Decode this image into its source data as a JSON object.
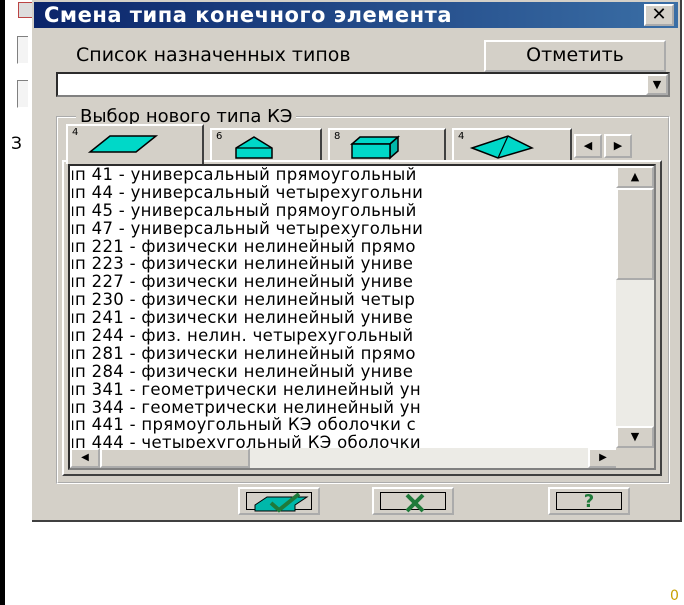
{
  "dialog": {
    "title": "Смена типа конечного элемента",
    "close_glyph": "✕"
  },
  "assigned": {
    "label": "Список назначенных типов",
    "mark_button": "Отметить",
    "combo_value": ""
  },
  "selection": {
    "group_label": "Выбор нового  типа  КЭ",
    "tabs": [
      {
        "num": "4",
        "icon": "parallelogram-plate-icon",
        "active": true
      },
      {
        "num": "6",
        "icon": "prism-icon",
        "active": false
      },
      {
        "num": "8",
        "icon": "box-icon",
        "active": false
      },
      {
        "num": "4",
        "icon": "tetrahedron-icon",
        "active": false
      }
    ],
    "items": [
      "ип 41 - универсальный прямоугольный",
      "ип 44 - универсальный четырехугольни",
      "ип 45 - универсальный прямоугольный",
      "ип 47 - универсальный четырехугольни",
      "ип 221 - физически нелинейный прямо",
      "ип 223 - физически нелинейный униве",
      "ип 227 - физически нелинейный униве",
      "ип 230 - физически нелинейный четыр",
      "ип 241 - физически нелинейный униве",
      "ип 244 - физ. нелин. четырехугольный",
      "ип 281 - физически нелинейный прямо",
      "ип 284 - физически нелинейный униве",
      "ип 341 - геометрически нелинейный ун",
      "ип 344 - геометрически нелинейный ун",
      "ип 441 - прямоугольный КЭ оболочки с",
      "ип 444 - четырехугольный КЭ оболочки"
    ]
  },
  "buttons": {
    "ok_icon": "check-icon",
    "cancel_icon": "cross-icon",
    "help_icon": "help-icon",
    "help_glyph": "?"
  },
  "background": {
    "side_text": "З",
    "corner_text": "0"
  },
  "colors": {
    "titlebar": "#0a246a",
    "face": "#d4d0c8",
    "icon_fill": "#00d8c8",
    "ok_green": "#2e8b57"
  }
}
